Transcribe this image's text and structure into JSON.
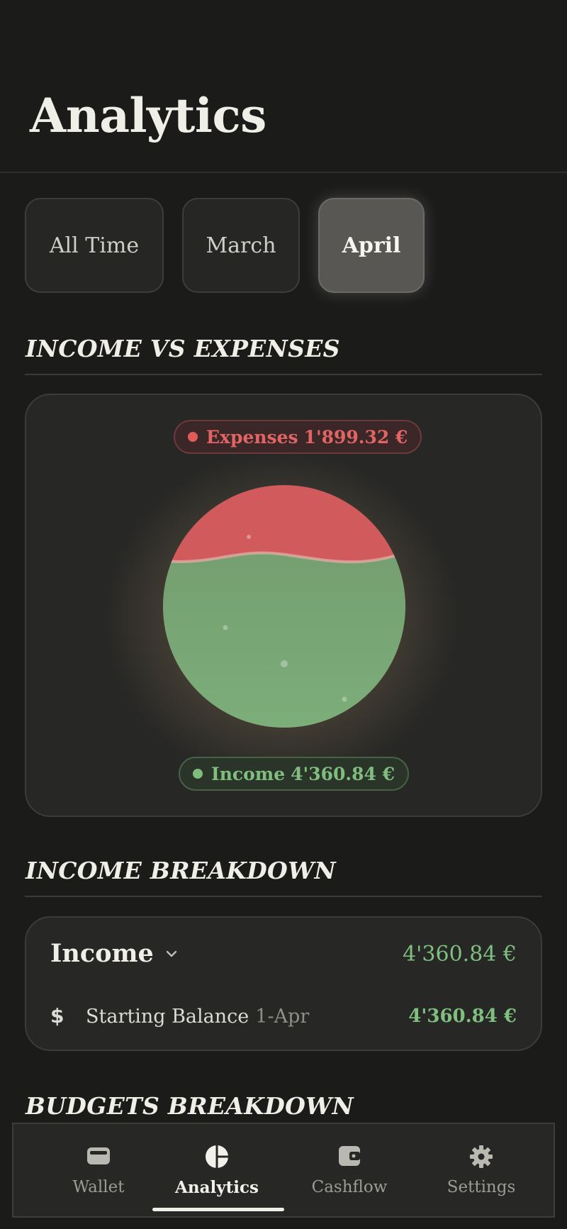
{
  "header": {
    "title": "Analytics"
  },
  "filters": [
    {
      "label": "All Time",
      "selected": false
    },
    {
      "label": "March",
      "selected": false
    },
    {
      "label": "April",
      "selected": true
    }
  ],
  "sections": {
    "income_vs_expenses": "INCOME VS EXPENSES",
    "income_breakdown": "INCOME BREAKDOWN",
    "budgets_breakdown": "BUDGETS BREAKDOWN"
  },
  "chart_data": {
    "type": "pie",
    "categories": [
      "Expenses",
      "Income"
    ],
    "values": [
      1899.32,
      4360.84
    ],
    "labels": [
      "Expenses 1'899.32 €",
      "Income 4'360.84 €"
    ],
    "colors": [
      "#d05a5c",
      "#7aab78"
    ],
    "legend": {
      "expenses": {
        "label": "Expenses",
        "value": "1'899.32 €"
      },
      "income": {
        "label": "Income",
        "value": "4'360.84 €"
      }
    }
  },
  "income_breakdown": {
    "title": "Income",
    "total": "4'360.84 €",
    "rows": [
      {
        "icon": "dollar-icon",
        "label": "Starting Balance",
        "date": "1-Apr",
        "amount": "4'360.84 €"
      }
    ]
  },
  "tabbar": {
    "tabs": [
      {
        "label": "Wallet",
        "icon": "wallet-icon",
        "active": false
      },
      {
        "label": "Analytics",
        "icon": "pie-chart-icon",
        "active": true
      },
      {
        "label": "Cashflow",
        "icon": "cashflow-icon",
        "active": false
      },
      {
        "label": "Settings",
        "icon": "gear-icon",
        "active": false
      }
    ]
  },
  "colors": {
    "background": "#1b1b1a",
    "card": "#272726",
    "expense": "#d05a5c",
    "income": "#7aab78",
    "income_text": "#7fbf7f"
  }
}
